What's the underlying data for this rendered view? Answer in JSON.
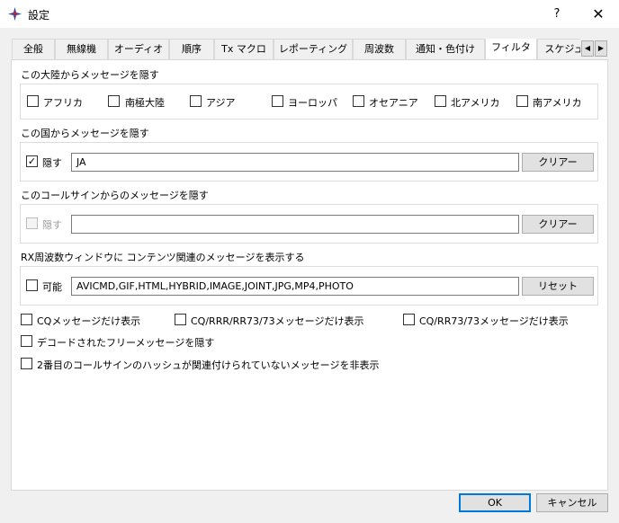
{
  "window": {
    "title": "設定",
    "help_label": "?",
    "close_label": "✕"
  },
  "tabs": [
    {
      "label": "全般",
      "active": false
    },
    {
      "label": "無線機",
      "active": false
    },
    {
      "label": "オーディオ",
      "active": false
    },
    {
      "label": "順序",
      "active": false
    },
    {
      "label": "Tx マクロ",
      "active": false
    },
    {
      "label": "レポーティング",
      "active": false
    },
    {
      "label": "周波数",
      "active": false
    },
    {
      "label": "通知・色付け",
      "active": false
    },
    {
      "label": "フィルタ",
      "active": true
    },
    {
      "label": "スケジュ",
      "active": false
    }
  ],
  "tab_scroll": {
    "left": "◀",
    "right": "▶"
  },
  "continent_filter": {
    "title": "この大陸からメッセージを隠す",
    "items": [
      {
        "label": "アフリカ",
        "checked": false
      },
      {
        "label": "南極大陸",
        "checked": false
      },
      {
        "label": "アジア",
        "checked": false
      },
      {
        "label": "ヨーロッパ",
        "checked": false
      },
      {
        "label": "オセアニア",
        "checked": false
      },
      {
        "label": "北アメリカ",
        "checked": false
      },
      {
        "label": "南アメリカ",
        "checked": false
      }
    ]
  },
  "country_filter": {
    "title": "この国からメッセージを隠す",
    "checkbox_label": "隠す",
    "checked": true,
    "check_mark": "✓",
    "value": "JA",
    "clear_label": "クリアー"
  },
  "callsign_filter": {
    "title": "このコールサインからのメッセージを隠す",
    "checkbox_label": "隠す",
    "checked": false,
    "enabled": false,
    "value": "",
    "clear_label": "クリアー"
  },
  "content_filter": {
    "title": "RX周波数ウィンドウに コンテンツ関連のメッセージを表示する",
    "checkbox_label": "可能",
    "checked": false,
    "value": "AVICMD,GIF,HTML,HYBRID,IMAGE,JOINT,JPG,MP4,PHOTO",
    "reset_label": "リセット"
  },
  "options": {
    "cq_only": {
      "label": "CQメッセージだけ表示",
      "checked": false
    },
    "cq_rrr_only": {
      "label": "CQ/RRR/RR73/73メッセージだけ表示",
      "checked": false
    },
    "cq_rr73_only": {
      "label": "CQ/RR73/73メッセージだけ表示",
      "checked": false
    },
    "hide_free": {
      "label": "デコードされたフリーメッセージを隠す",
      "checked": false
    },
    "hide_unlinked_hash": {
      "label": "2番目のコールサインのハッシュが関連付けられていないメッセージを非表示",
      "checked": false
    }
  },
  "footer": {
    "ok_label": "OK",
    "cancel_label": "キャンセル"
  },
  "colors": {
    "accent": "#0078d7",
    "panel_bg": "#ffffff",
    "window_bg": "#f0f0f0"
  }
}
